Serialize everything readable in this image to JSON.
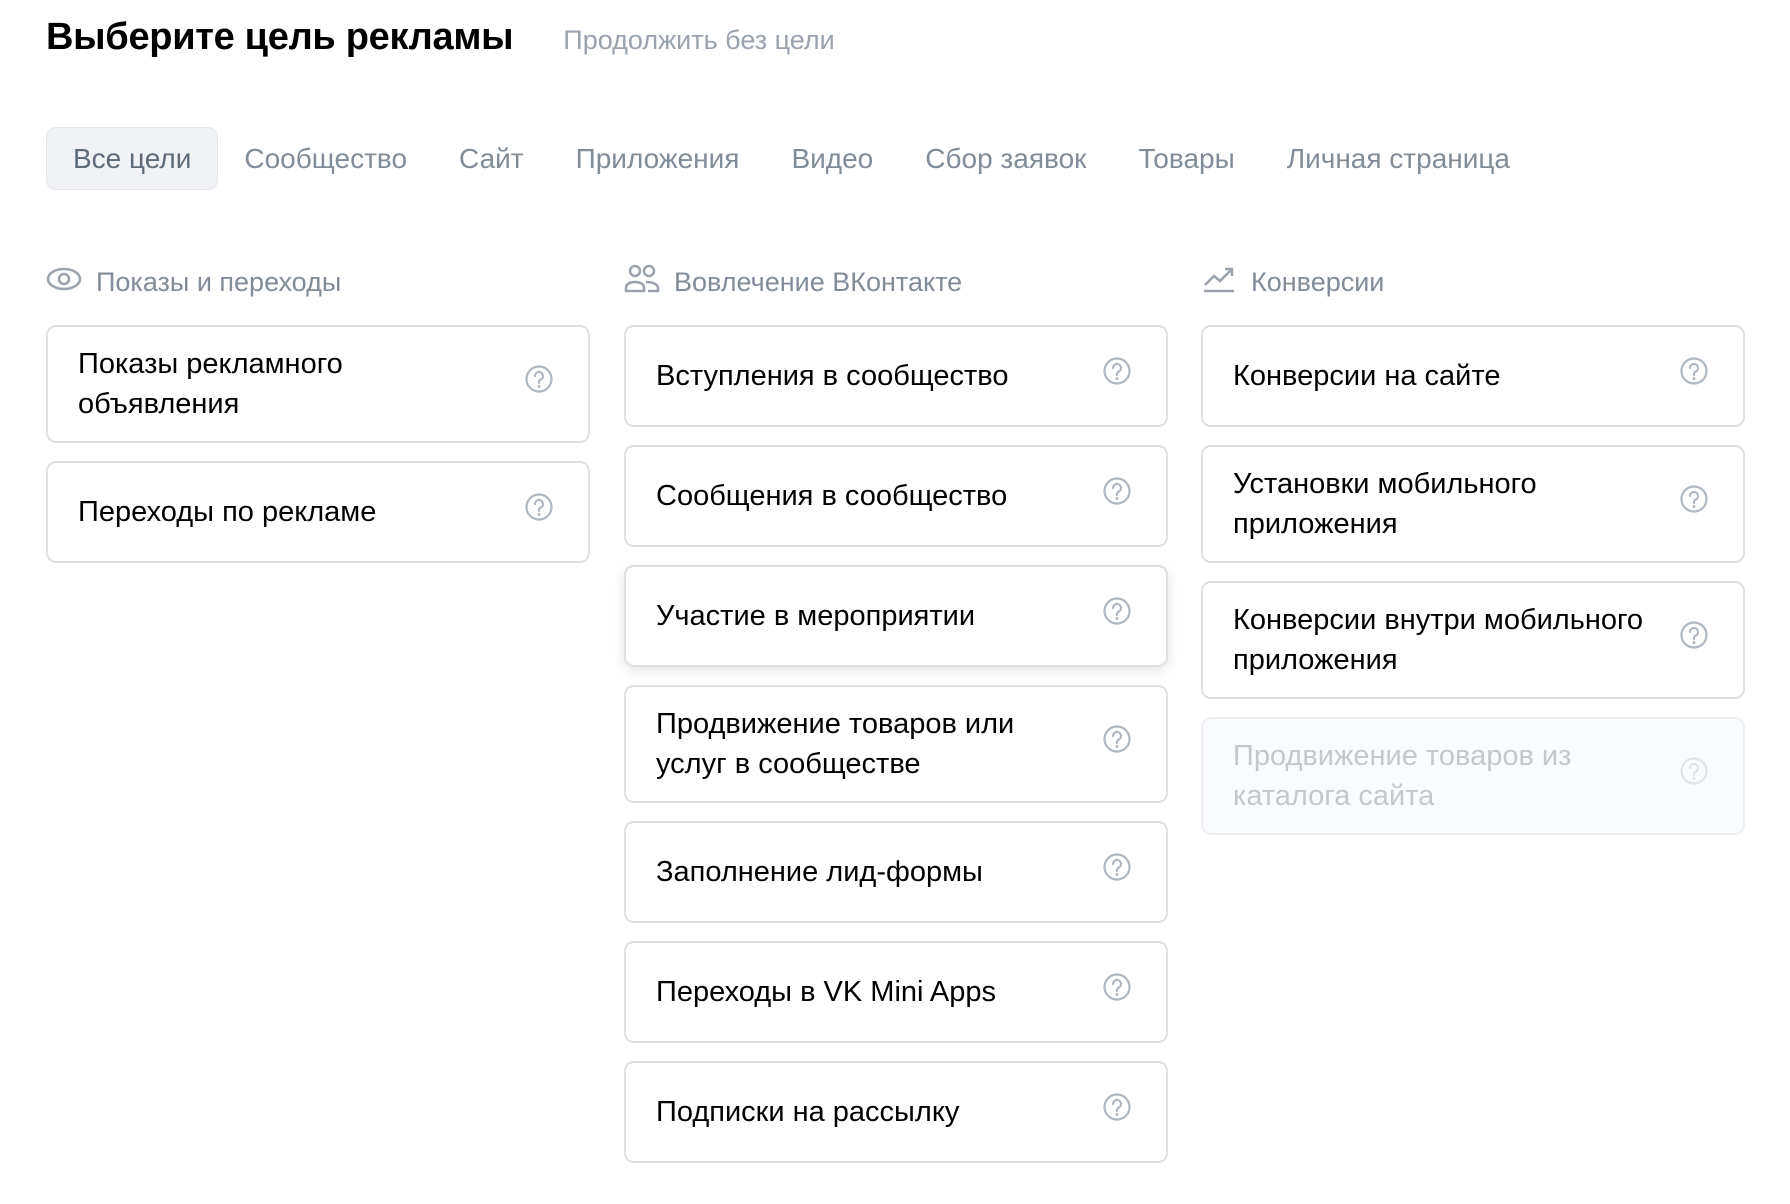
{
  "header": {
    "title": "Выберите цель рекламы",
    "skip_link": "Продолжить без цели"
  },
  "tabs": [
    {
      "label": "Все цели",
      "active": true
    },
    {
      "label": "Сообщество"
    },
    {
      "label": "Сайт"
    },
    {
      "label": "Приложения"
    },
    {
      "label": "Видео"
    },
    {
      "label": "Сбор заявок"
    },
    {
      "label": "Товары"
    },
    {
      "label": "Личная страница"
    }
  ],
  "sections": [
    {
      "title": "Показы и переходы",
      "icon": "eye-icon",
      "items": [
        "Показы рекламного объявления",
        "Переходы по рекламе"
      ]
    },
    {
      "title": "Вовлечение ВКонтакте",
      "icon": "users-icon",
      "items": [
        "Вступления в сообщество",
        "Сообщения в сообщество",
        "Участие в мероприятии",
        "Продвижение товаров или услуг в сообществе",
        "Заполнение лид-формы",
        "Переходы в VK Mini Apps",
        "Подписки на рассылку"
      ]
    },
    {
      "title": "Конверсии",
      "icon": "trend-up-icon",
      "items": [
        "Конверсии на сайте",
        "Установки мобильного приложения",
        "Конверсии внутри мобильного приложения",
        "Продвижение товаров из каталога сайта"
      ]
    }
  ]
}
